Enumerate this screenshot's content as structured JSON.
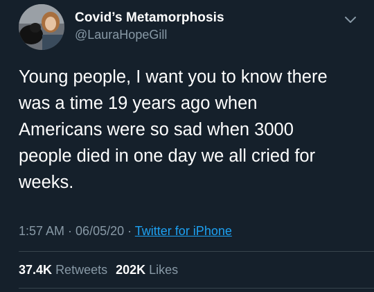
{
  "author": {
    "display_name": "Covid’s Metamorphosis",
    "handle": "@LauraHopeGill"
  },
  "tweet": {
    "text": "Young people, I want you to know there\nwas a time 19 years ago when\nAmericans were so sad when 3000\npeople died in one day we all cried for\nweeks."
  },
  "meta": {
    "time": "1:57 AM",
    "separator1": " · ",
    "date": "06/05/20",
    "separator2": " · ",
    "source": "Twitter for iPhone"
  },
  "stats": {
    "retweets_count": "37.4K",
    "retweets_label": "Retweets",
    "likes_count": "202K",
    "likes_label": "Likes"
  },
  "colors": {
    "background": "#15202b",
    "secondary_text": "#8899a6",
    "accent": "#1da1f2",
    "divider": "#38444d"
  },
  "icons": {
    "more": "chevron-down-icon"
  }
}
